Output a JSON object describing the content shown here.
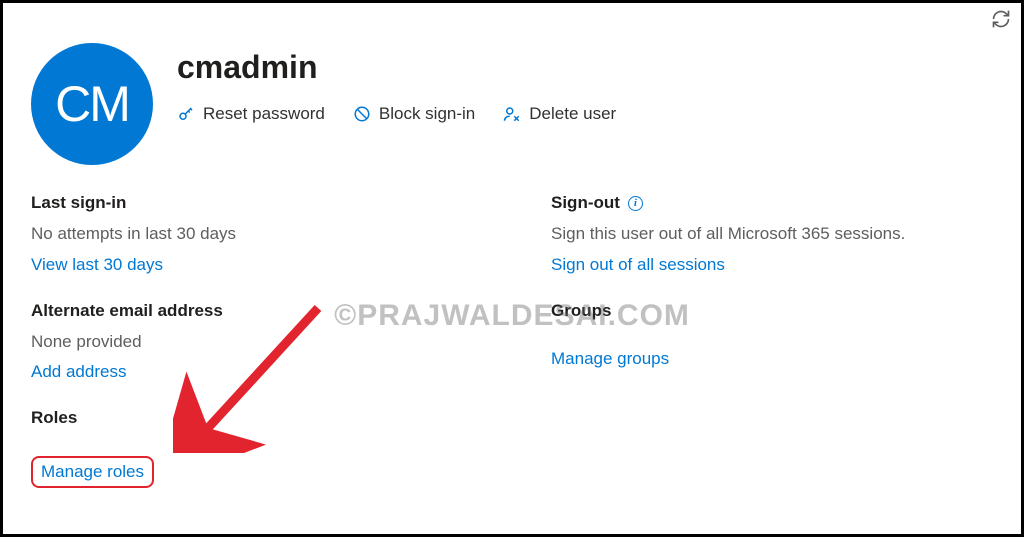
{
  "avatar_initials": "CM",
  "username": "cmadmin",
  "actions": {
    "reset_password": "Reset password",
    "block_signin": "Block sign-in",
    "delete_user": "Delete user"
  },
  "left": {
    "last_signin": {
      "title": "Last sign-in",
      "body": "No attempts in last 30 days",
      "link": "View last 30 days"
    },
    "alt_email": {
      "title": "Alternate email address",
      "body": "None provided",
      "link": "Add address"
    },
    "roles": {
      "title": "Roles",
      "link": "Manage roles"
    }
  },
  "right": {
    "sign_out": {
      "title": "Sign-out",
      "body": "Sign this user out of all Microsoft 365 sessions.",
      "link": "Sign out of all sessions"
    },
    "groups": {
      "title": "Groups",
      "link": "Manage groups"
    }
  },
  "watermark": "©PRAJWALDESAI.COM"
}
